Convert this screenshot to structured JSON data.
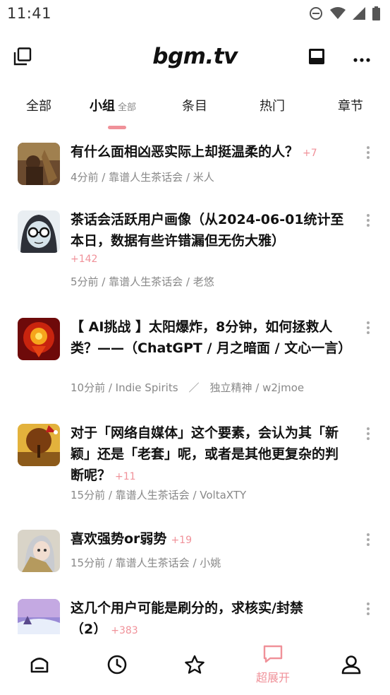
{
  "status_bar": {
    "time": "11:41",
    "icons": [
      "do-not-disturb-icon",
      "wifi-icon",
      "signal-icon",
      "battery-icon"
    ]
  },
  "app_bar": {
    "logo": "bgm.tv",
    "left_icon": "copy-icon",
    "right_icons": [
      "inbox-icon",
      "more-horizontal-icon"
    ]
  },
  "tabs": {
    "items": [
      {
        "label": "全部"
      },
      {
        "label": "小组",
        "sub": "全部",
        "active": true
      },
      {
        "label": "条目"
      },
      {
        "label": "热门"
      },
      {
        "label": "章节"
      }
    ]
  },
  "topics": [
    {
      "title": "有什么面相凶恶实际上却挺温柔的人？",
      "count": "+7",
      "meta": "4分前 / 靠谱人生茶话会 / 米人"
    },
    {
      "title": "茶话会活跃用户画像（从2024-06-01统计至本日，数据有些许错漏但无伤大雅）",
      "count": "+142",
      "meta": "5分前 / 靠谱人生茶话会 / 老悠"
    },
    {
      "title": "【 AI挑战 】太阳爆炸，8分钟，如何拯救人类？——（ChatGPT / 月之暗面 / 文心一言）",
      "count": "",
      "meta": "10分前 / Indie Spirits　／　独立精神 / w2jmoe"
    },
    {
      "title": "对于「网络自媒体」这个要素，会认为其「新颖」还是「老套」呢，或者是其他更复杂的判断呢？",
      "count": "+11",
      "meta": "15分前 / 靠谱人生茶话会 / VoltaXTY"
    },
    {
      "title": "喜欢强势or弱势",
      "count": "+19",
      "meta": "15分前 / 靠谱人生茶话会 / 小姚"
    },
    {
      "title": "这几个用户可能是刷分的，求核实/封禁（2）",
      "count": "+383",
      "meta": ""
    }
  ],
  "bottom_nav": {
    "items": [
      {
        "icon": "home-icon",
        "label": ""
      },
      {
        "icon": "clock-icon",
        "label": ""
      },
      {
        "icon": "star-icon",
        "label": ""
      },
      {
        "icon": "message-icon",
        "label": "超展开",
        "active": true
      },
      {
        "icon": "user-icon",
        "label": ""
      }
    ]
  },
  "colors": {
    "accent": "#f09199",
    "text": "#111111",
    "muted": "#888888"
  }
}
